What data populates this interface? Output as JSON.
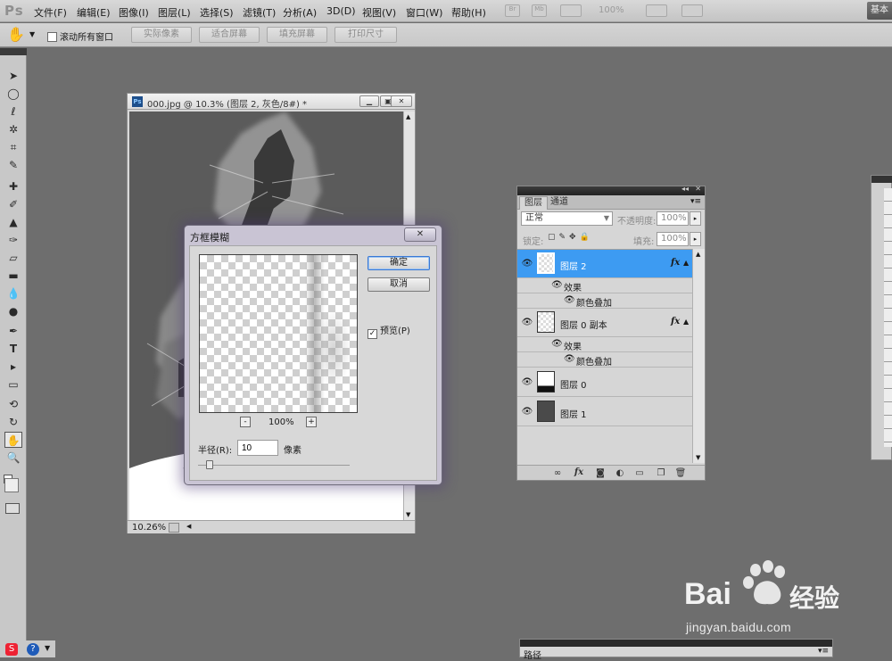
{
  "app": {
    "logo": "Ps",
    "workspace": "基本"
  },
  "menu": [
    "文件(F)",
    "编辑(E)",
    "图像(I)",
    "图层(L)",
    "选择(S)",
    "滤镜(T)",
    "分析(A)",
    "3D(D)",
    "视图(V)",
    "窗口(W)",
    "帮助(H)"
  ],
  "menubar_right": {
    "zoom": "100%",
    "br_label": "Br",
    "mb_label": "Mb"
  },
  "options_bar": {
    "scroll_all": "滚动所有窗口",
    "buttons": [
      "实际像素",
      "适合屏幕",
      "填充屏幕",
      "打印尺寸"
    ]
  },
  "document": {
    "title": "000.jpg @ 10.3% (图层 2, 灰色/8#) *",
    "zoom": "10.26%"
  },
  "dialog": {
    "title": "方框模糊",
    "ok": "确定",
    "cancel": "取消",
    "preview_label": "预览(P)",
    "zoom_minus": "-",
    "zoom_plus": "+",
    "zoom": "100%",
    "radius_label": "半径(R):",
    "radius_value": "10",
    "radius_unit": "像素",
    "radius_fraction": 0.05
  },
  "layers_panel": {
    "tabs": [
      "图层",
      "通道"
    ],
    "blend_mode": "正常",
    "opacity_label": "不透明度:",
    "opacity": "100%",
    "lock_label": "锁定:",
    "fill_label": "填充:",
    "fill": "100%",
    "layers": [
      {
        "name": "图层 2",
        "fx": "fx",
        "effects_label": "效果",
        "effect": "颜色叠加",
        "selected": true
      },
      {
        "name": "图层 0 副本",
        "fx": "fx",
        "effects_label": "效果",
        "effect": "颜色叠加",
        "selected": false
      },
      {
        "name": "图层 0",
        "selected": false
      },
      {
        "name": "图层 1",
        "selected": false
      }
    ],
    "footer_icons": [
      "link-icon",
      "fx-icon",
      "mask-icon",
      "adjustment-icon",
      "group-icon",
      "new-layer-icon",
      "trash-icon"
    ]
  },
  "bottom_panel": {
    "tab": "路径"
  },
  "watermark": {
    "brand": "Bai",
    "brand_cn": "经验",
    "url": "jingyan.baidu.com"
  },
  "colors": {
    "selected_layer": "#3d9bf2",
    "dialog_frame": "#c9c4d4",
    "workspace": "#6e6e6e"
  }
}
